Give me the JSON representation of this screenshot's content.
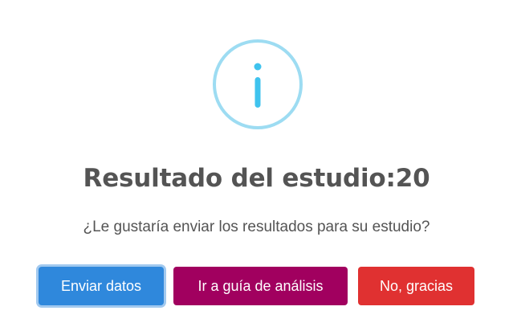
{
  "dialog": {
    "icon": "info-icon",
    "icon_color": "#9ddcf2",
    "icon_glyph_color": "#3fc3ee",
    "title": "Resultado del estudio:20",
    "message": "¿Le gustaría enviar los resultados para su estudio?",
    "buttons": {
      "confirm_label": "Enviar datos",
      "deny_label": "Ir a guía de análisis",
      "cancel_label": "No, gracias"
    },
    "colors": {
      "confirm": "#2f88dc",
      "deny": "#a1005f",
      "cancel": "#e03131",
      "text": "#545454"
    }
  }
}
